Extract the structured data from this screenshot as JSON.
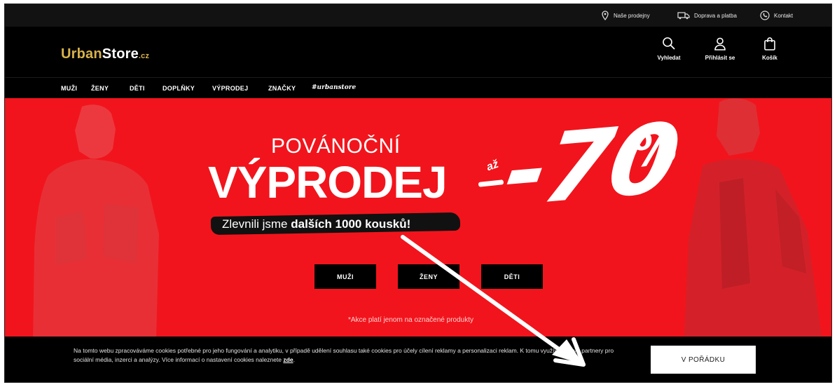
{
  "utility_bar": {
    "stores": "Naše prodejny",
    "shipping": "Doprava a platba",
    "contact": "Kontakt"
  },
  "header": {
    "logo_urban": "Urban",
    "logo_store": "Store",
    "logo_tld": ".cz",
    "search_label": "Vyhledat",
    "login_label": "Přihlásit se",
    "cart_label": "Košík"
  },
  "nav": {
    "items": [
      "MUŽI",
      "ŽENY",
      "DĚTI",
      "DOPLŇKY",
      "VÝPRODEJ",
      "ZNAČKY"
    ],
    "brand": "#urbanstore"
  },
  "hero": {
    "subtitle": "POVÁNOČNÍ",
    "title": "VÝPRODEJ",
    "az": "až",
    "discount": "-70",
    "percent": "%",
    "tagline_normal": "Zlevnili jsme ",
    "tagline_bold": "dalších 1000 kousků!",
    "cta_men": "MUŽI",
    "cta_women": "ŽENY",
    "cta_kids": "DĚTI",
    "disclaimer": "*Akce platí jenom na označené produkty"
  },
  "cookie": {
    "text": "Na tomto webu zpracováváme cookies potřebné pro jeho fungování a analytiku, v případě udělení souhlasu také cookies pro účely cílení reklamy a personalizaci reklam. K tomu využíváme své partnery pro sociální média, inzerci a analýzy. Více informací o nastavení cookies naleznete ",
    "link": "zde",
    "button": "V POŘÁDKU"
  },
  "colors": {
    "hero_red": "#f2141c",
    "logo_gold": "#d8b24a",
    "annotation_arrow": "#ffffff"
  }
}
